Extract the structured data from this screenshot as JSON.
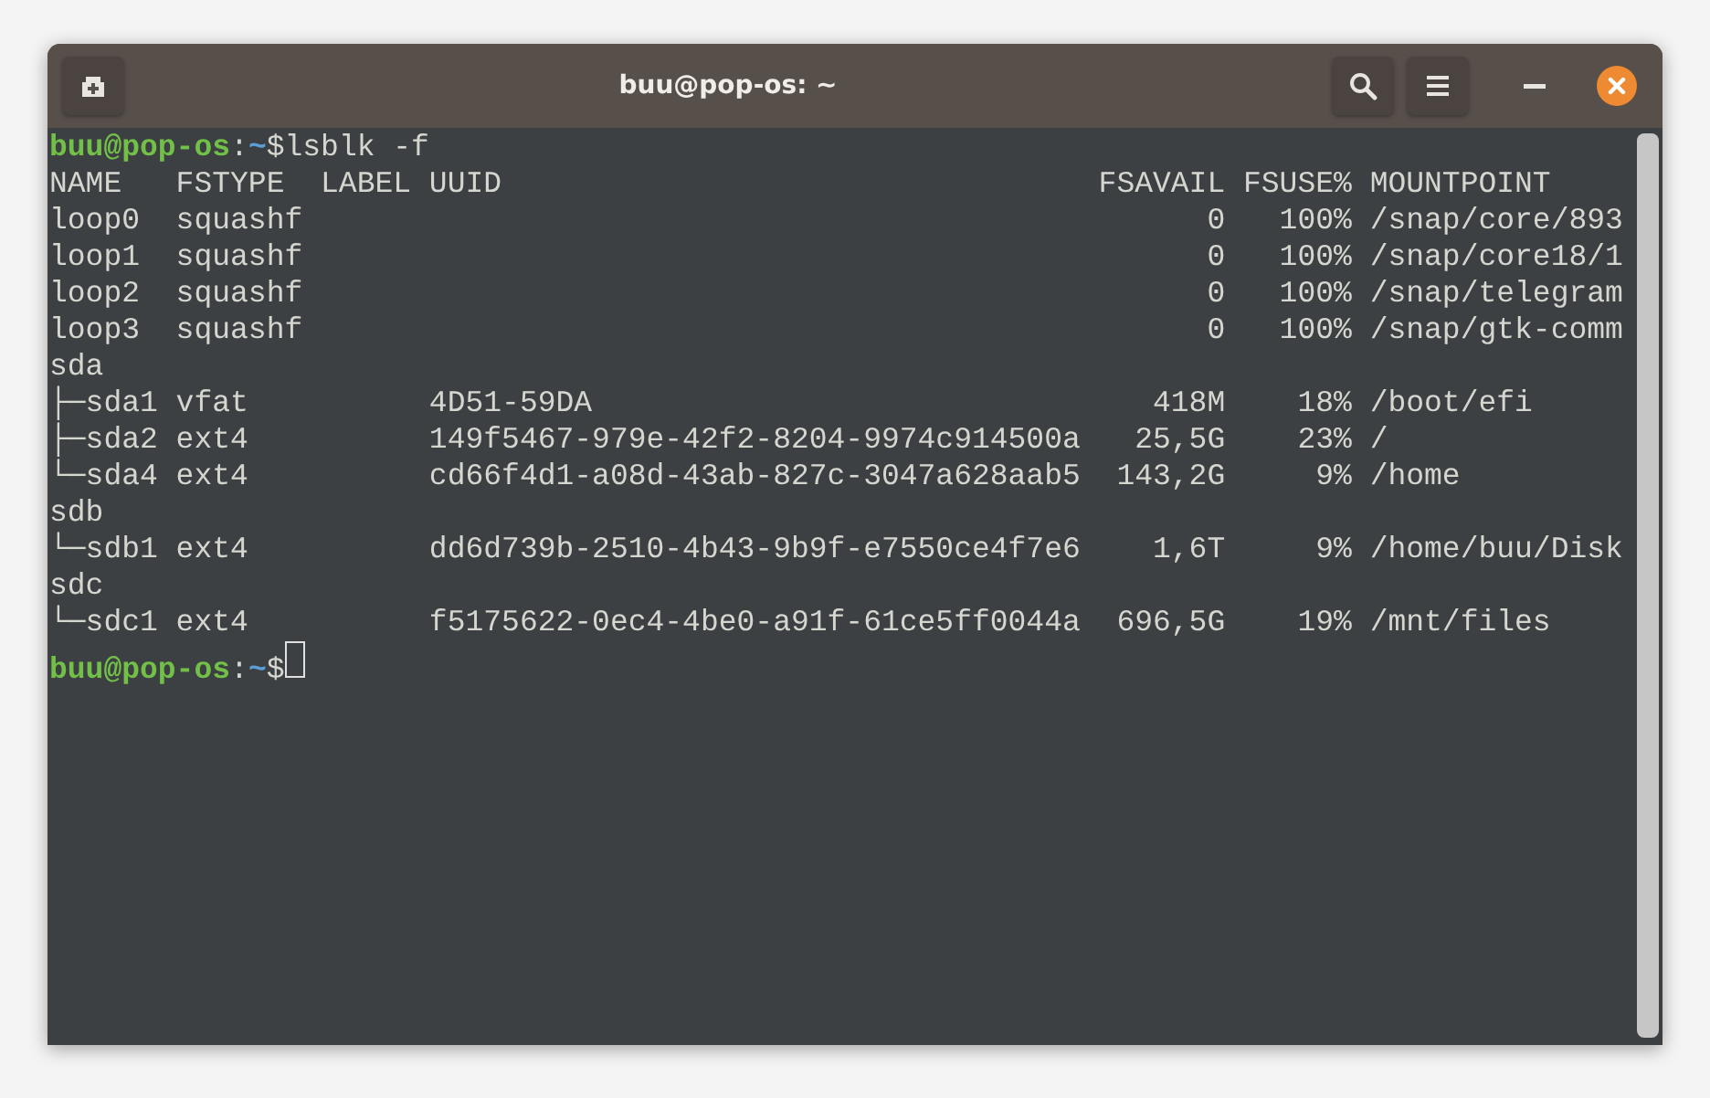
{
  "window": {
    "title": "buu@pop-os: ~"
  },
  "terminal": {
    "lines": [
      {
        "kind": "prompt",
        "user_host": "buu@pop-os",
        "separator": ":",
        "path": "~",
        "symbol": "$",
        "command": "lsblk -f",
        "cursor": false
      },
      {
        "kind": "output",
        "text": "NAME   FSTYPE  LABEL UUID                                 FSAVAIL FSUSE% MOUNTPOINT"
      },
      {
        "kind": "output",
        "text": "loop0  squashf                                                  0   100% /snap/core/893"
      },
      {
        "kind": "output",
        "text": "loop1  squashf                                                  0   100% /snap/core18/1"
      },
      {
        "kind": "output",
        "text": "loop2  squashf                                                  0   100% /snap/telegram"
      },
      {
        "kind": "output",
        "text": "loop3  squashf                                                  0   100% /snap/gtk-comm"
      },
      {
        "kind": "output",
        "text": "sda"
      },
      {
        "kind": "output",
        "text": "├─sda1 vfat          4D51-59DA                               418M    18% /boot/efi"
      },
      {
        "kind": "output",
        "text": "├─sda2 ext4          149f5467-979e-42f2-8204-9974c914500a   25,5G    23% /"
      },
      {
        "kind": "output",
        "text": "└─sda4 ext4          cd66f4d1-a08d-43ab-827c-3047a628aab5  143,2G     9% /home"
      },
      {
        "kind": "output",
        "text": "sdb"
      },
      {
        "kind": "output",
        "text": "└─sdb1 ext4          dd6d739b-2510-4b43-9b9f-e7550ce4f7e6    1,6T     9% /home/buu/Disk"
      },
      {
        "kind": "output",
        "text": "sdc"
      },
      {
        "kind": "output",
        "text": "└─sdc1 ext4          f5175622-0ec4-4be0-a91f-61ce5ff0044a  696,5G    19% /mnt/files"
      },
      {
        "kind": "prompt",
        "user_host": "buu@pop-os",
        "separator": ":",
        "path": "~",
        "symbol": "$",
        "cursor": true
      }
    ]
  }
}
